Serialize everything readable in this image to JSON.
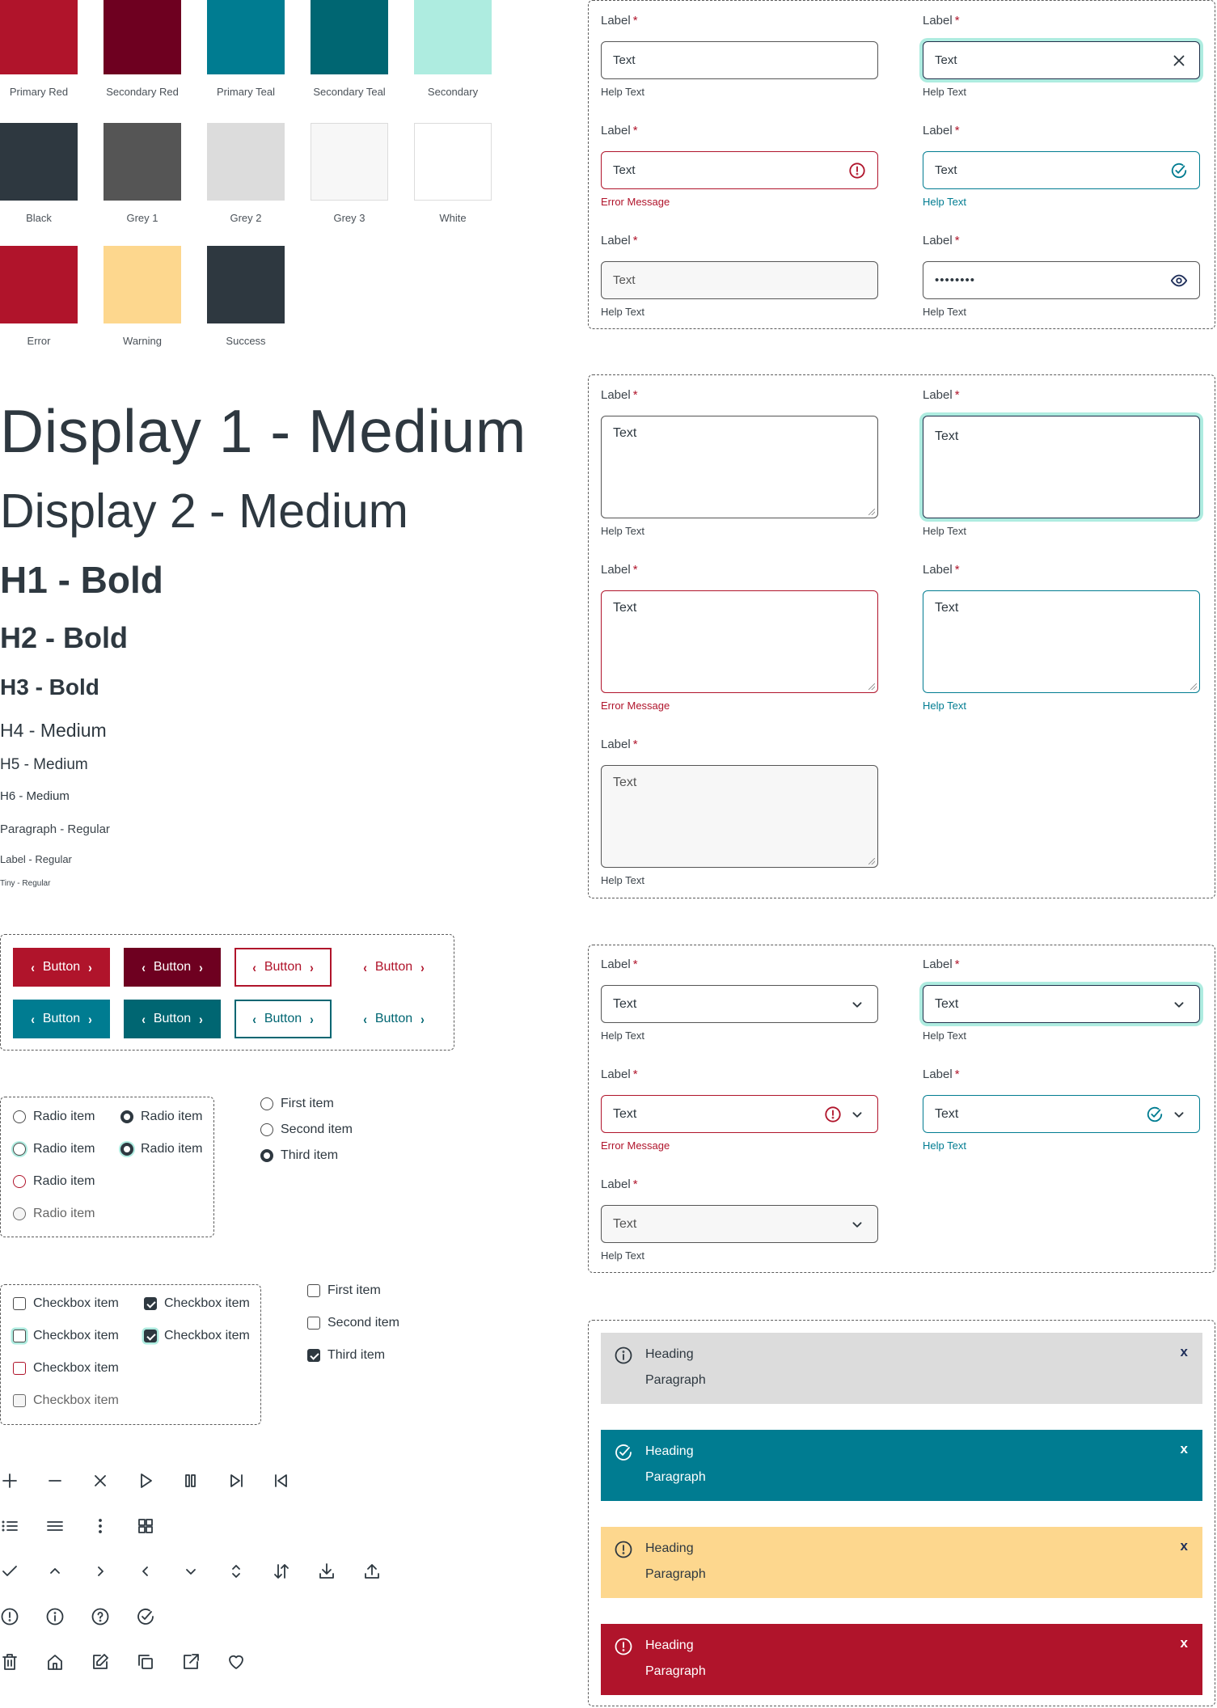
{
  "colors": [
    {
      "name": "Primary Red",
      "hex": "#b0142b"
    },
    {
      "name": "Secondary Red",
      "hex": "#6e0020"
    },
    {
      "name": "Primary Teal",
      "hex": "#007c91"
    },
    {
      "name": "Secondary Teal",
      "hex": "#006672"
    },
    {
      "name": "Secondary",
      "hex": "#aeece0"
    },
    {
      "name": "Black",
      "hex": "#2e3840"
    },
    {
      "name": "Grey 1",
      "hex": "#555555"
    },
    {
      "name": "Grey 2",
      "hex": "#dcdcdc"
    },
    {
      "name": "Grey 3",
      "hex": "#f7f7f7"
    },
    {
      "name": "White",
      "hex": "#ffffff"
    },
    {
      "name": "Error",
      "hex": "#b0142b"
    },
    {
      "name": "Warning",
      "hex": "#fdd78e"
    },
    {
      "name": "Success",
      "hex": "#2e3840"
    }
  ],
  "typography": {
    "display1": "Display 1 - Medium",
    "display2": "Display 2 - Medium",
    "h1": "H1 - Bold",
    "h2": "H2 - Bold",
    "h3": "H3 - Bold",
    "h4": "H4 - Medium",
    "h5": "H5 - Medium",
    "h6": "H6 - Medium",
    "paragraph": "Paragraph - Regular",
    "label": "Label - Regular",
    "tiny": "Tiny - Regular"
  },
  "buttons": {
    "label": "Button",
    "chevron_left": "‹",
    "chevron_right": "›"
  },
  "radios": {
    "group_items": [
      {
        "label": "Radio item",
        "state": "default",
        "checked": false
      },
      {
        "label": "Radio item",
        "state": "default",
        "checked": true
      },
      {
        "label": "Radio item",
        "state": "focus",
        "checked": false
      },
      {
        "label": "Radio item",
        "state": "focus",
        "checked": true
      },
      {
        "label": "Radio item",
        "state": "error",
        "checked": false
      },
      {
        "label": "Radio item",
        "state": "disabled",
        "checked": false
      }
    ],
    "list": [
      {
        "label": "First item",
        "checked": false
      },
      {
        "label": "Second item",
        "checked": false
      },
      {
        "label": "Third item",
        "checked": true
      }
    ]
  },
  "checkboxes": {
    "group_items": [
      {
        "label": "Checkbox item",
        "state": "default",
        "checked": false
      },
      {
        "label": "Checkbox item",
        "state": "default",
        "checked": true
      },
      {
        "label": "Checkbox item",
        "state": "focus",
        "checked": false
      },
      {
        "label": "Checkbox item",
        "state": "focus",
        "checked": true
      },
      {
        "label": "Checkbox item",
        "state": "error",
        "checked": false
      },
      {
        "label": "Checkbox item",
        "state": "disabled",
        "checked": false
      }
    ],
    "list": [
      {
        "label": "First item",
        "checked": false
      },
      {
        "label": "Second item",
        "checked": false
      },
      {
        "label": "Third item",
        "checked": true
      }
    ]
  },
  "icons": {
    "row1": [
      "plus-icon",
      "minus-icon",
      "close-icon",
      "play-icon",
      "pause-icon",
      "skip-forward-icon",
      "skip-back-icon"
    ],
    "row2": [
      "list-icon",
      "menu-icon",
      "more-vertical-icon",
      "grid-icon"
    ],
    "row3": [
      "check-icon",
      "chevron-up-icon",
      "chevron-right-icon",
      "chevron-left-icon",
      "chevron-down-icon",
      "chevron-up-down-icon",
      "sort-icon",
      "download-icon",
      "upload-icon"
    ],
    "row4": [
      "alert-circle-icon",
      "info-circle-icon",
      "help-circle-icon",
      "check-circle-icon"
    ],
    "row5": [
      "trash-icon",
      "home-icon",
      "edit-icon",
      "copy-icon",
      "external-link-icon",
      "heart-icon"
    ]
  },
  "inputs": {
    "label": "Label",
    "required": "*",
    "value": "Text",
    "password_mask": "••••••••",
    "help": "Help Text",
    "error": "Error Message"
  },
  "alerts": [
    {
      "type": "info",
      "heading": "Heading",
      "paragraph": "Paragraph",
      "close": "x"
    },
    {
      "type": "success",
      "heading": "Heading",
      "paragraph": "Paragraph",
      "close": "x"
    },
    {
      "type": "warning",
      "heading": "Heading",
      "paragraph": "Paragraph",
      "close": "x"
    },
    {
      "type": "error",
      "heading": "Heading",
      "paragraph": "Paragraph",
      "close": "x"
    }
  ]
}
